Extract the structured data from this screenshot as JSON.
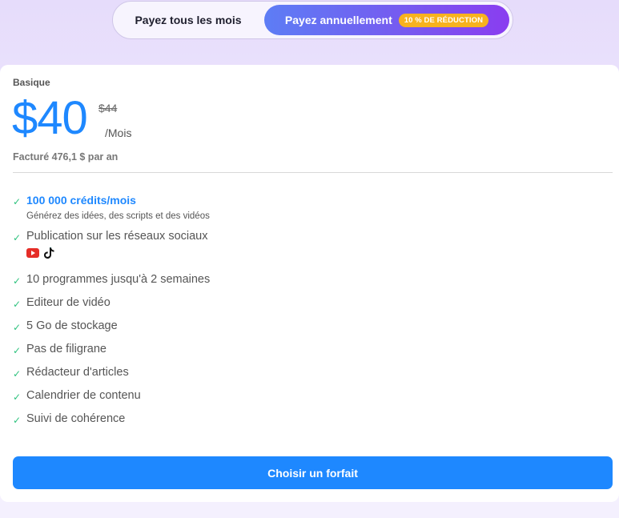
{
  "billing_toggle": {
    "monthly_label": "Payez tous les mois",
    "annual_label": "Payez annuellement",
    "annual_badge": "10 % DE RÉDUCTION"
  },
  "plan": {
    "name": "Basique",
    "price": "$40",
    "old_price": "$44",
    "period": "/Mois",
    "billed_note": "Facturé 476,1 $ par an",
    "cta_label": "Choisir un forfait"
  },
  "features": [
    {
      "text": "100 000 crédits/mois",
      "sub": "Générez des idées, des scripts et des vidéos"
    },
    {
      "text": "Publication sur les réseaux sociaux",
      "icons": [
        "youtube-icon",
        "tiktok-icon"
      ]
    },
    {
      "text": "10 programmes jusqu'à 2 semaines"
    },
    {
      "text": "Editeur de vidéo"
    },
    {
      "text": "5 Go de stockage"
    },
    {
      "text": "Pas de filigrane"
    },
    {
      "text": "Rédacteur d'articles"
    },
    {
      "text": "Calendrier de contenu"
    },
    {
      "text": "Suivi de cohérence"
    }
  ],
  "colors": {
    "accent_blue": "#1e88ff",
    "check_green": "#2ec27e",
    "badge_orange": "#f7b21e",
    "youtube_red": "#e52d27"
  }
}
